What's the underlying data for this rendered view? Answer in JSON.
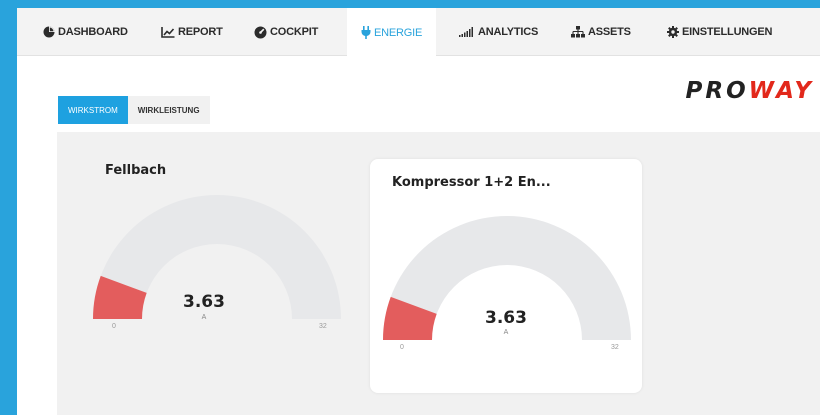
{
  "nav": {
    "items": [
      {
        "label": "DASHBOARD",
        "icon": "pie-chart-icon"
      },
      {
        "label": "REPORT",
        "icon": "line-chart-icon"
      },
      {
        "label": "COCKPIT",
        "icon": "speedometer-icon"
      },
      {
        "label": "ENERGIE",
        "icon": "plug-icon",
        "active": true
      },
      {
        "label": "ANALYTICS",
        "icon": "bar-signal-icon"
      },
      {
        "label": "ASSETS",
        "icon": "sitemap-icon"
      },
      {
        "label": "EINSTELLUNGEN",
        "icon": "gear-icon"
      }
    ]
  },
  "logo": {
    "part1": "PRO",
    "part2": "WAY"
  },
  "tabs": [
    {
      "label": "WIRKSTROM",
      "active": true
    },
    {
      "label": "WIRKLEISTUNG",
      "active": false
    }
  ],
  "gauges": [
    {
      "title": "Fellbach",
      "value": "3.63",
      "unit": "A",
      "min": "0",
      "max": "32",
      "fraction": 0.113
    },
    {
      "title": "Kompressor 1+2 En...",
      "value": "3.63",
      "unit": "A",
      "min": "0",
      "max": "32",
      "fraction": 0.113
    }
  ],
  "colors": {
    "accent": "#29a3dc",
    "gauge_fill": "#e35d5d",
    "gauge_track": "#e7e8ea",
    "logo_red": "#e2281b"
  }
}
